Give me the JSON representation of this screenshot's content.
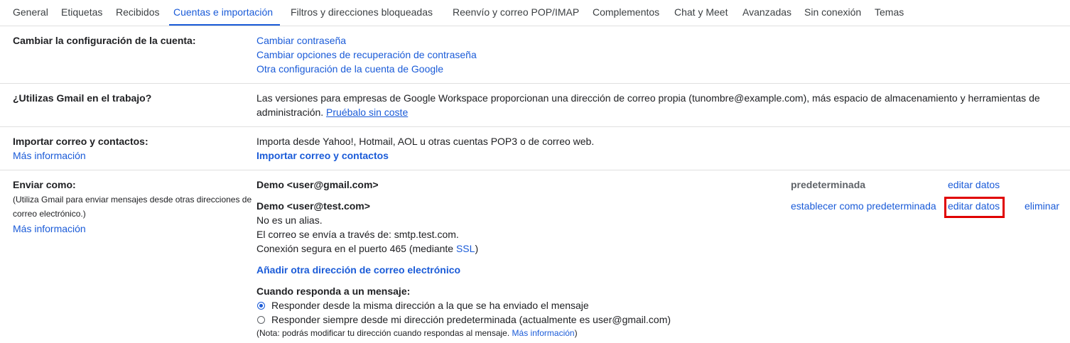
{
  "tabs": [
    {
      "label": "General"
    },
    {
      "label": "Etiquetas"
    },
    {
      "label": "Recibidos"
    },
    {
      "label": "Cuentas e importación"
    },
    {
      "label": "Filtros y direcciones bloqueadas"
    },
    {
      "label": "Reenvío y correo POP/IMAP"
    },
    {
      "label": "Complementos"
    },
    {
      "label": "Chat y Meet"
    },
    {
      "label": "Avanzadas"
    },
    {
      "label": "Sin conexión"
    },
    {
      "label": "Temas"
    }
  ],
  "account": {
    "label": "Cambiar la configuración de la cuenta:",
    "links": [
      "Cambiar contraseña",
      "Cambiar opciones de recuperación de contraseña",
      "Otra configuración de la cuenta de Google"
    ]
  },
  "work": {
    "label": "¿Utilizas Gmail en el trabajo?",
    "text_line1": "Las versiones para empresas de Google Workspace proporcionan una dirección de correo propia (tunombre@example.com), más espacio de almacenamiento y herramientas de",
    "text_line2": "administración.",
    "try_link": "Pruébalo sin coste"
  },
  "import": {
    "label": "Importar correo y contactos:",
    "more_info": "Más información",
    "description": "Importa desde Yahoo!, Hotmail, AOL u otras cuentas POP3 o de correo web.",
    "action": "Importar correo y contactos"
  },
  "send_as": {
    "label": "Enviar como:",
    "note_line1": "(Utiliza Gmail para enviar mensajes desde otras direcciones de",
    "note_line2": "correo electrónico.)",
    "more_info": "Más información",
    "accounts": [
      {
        "name": "Demo <user@gmail.com>",
        "status": "predeterminada",
        "edit": "editar datos"
      },
      {
        "name": "Demo <user@test.com>",
        "make_default": "establecer como predeterminada",
        "edit": "editar datos",
        "delete": "eliminar",
        "alias": "No es un alias.",
        "via": "El correo se envía a través de: smtp.test.com.",
        "secure_prefix": "Conexión segura en el puerto 465 (mediante",
        "ssl": "SSL",
        "secure_suffix": ")"
      }
    ],
    "add_address": "Añadir otra dirección de correo electrónico",
    "reply_heading": "Cuando responda a un mensaje:",
    "reply_options": [
      {
        "label": "Responder desde la misma dirección a la que se ha enviado el mensaje",
        "checked": true
      },
      {
        "label": "Responder siempre desde mi dirección predeterminada (actualmente es user@gmail.com)",
        "checked": false
      }
    ],
    "reply_note": "(Nota: podrás modificar tu dirección cuando respondas al mensaje.",
    "reply_note_link": "Más información",
    "reply_note_suffix": ")"
  },
  "colors": {
    "link": "#1a5bd8",
    "highlight": "#e00000"
  }
}
